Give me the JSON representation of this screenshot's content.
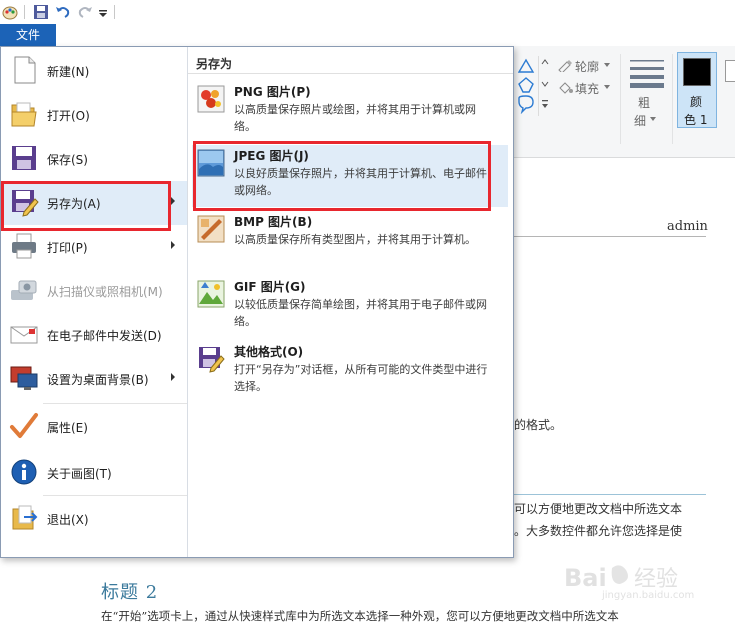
{
  "ribbon_tabs": {
    "file": "文件"
  },
  "ribbon": {
    "outline": "轮廓",
    "fill": "填充",
    "size_line1": "粗",
    "size_line2": "细",
    "color1_line1": "颜",
    "color1_line2": "色 1"
  },
  "document": {
    "author": "admin",
    "line_format": "的格式。",
    "line_a": "可以方便地更改文档中所选文本",
    "line_b": "。大多数控件都允许您选择是使",
    "heading2": "标题 2",
    "paragraph": "在“开始”选项卡上，通过从快速样式库中为所选文本选择一种外观，您可以方便地更改文档中所选文本"
  },
  "file_menu": {
    "items": [
      {
        "label": "新建(N)"
      },
      {
        "label": "打开(O)"
      },
      {
        "label": "保存(S)"
      },
      {
        "label": "另存为(A)"
      },
      {
        "label": "打印(P)"
      },
      {
        "label": "从扫描仪或照相机(M)"
      },
      {
        "label": "在电子邮件中发送(D)"
      },
      {
        "label": "设置为桌面背景(B)"
      },
      {
        "label": "属性(E)"
      },
      {
        "label": "关于画图(T)"
      },
      {
        "label": "退出(X)"
      }
    ]
  },
  "save_as": {
    "header": "另存为",
    "options": [
      {
        "title": "PNG 图片(P)",
        "desc": "以高质量保存照片或绘图，并将其用于计算机或网络。"
      },
      {
        "title": "JPEG 图片(J)",
        "desc": "以良好质量保存照片，并将其用于计算机、电子邮件或网络。"
      },
      {
        "title": "BMP 图片(B)",
        "desc": "以高质量保存所有类型图片，并将其用于计算机。"
      },
      {
        "title": "GIF 图片(G)",
        "desc": "以较低质量保存简单绘图，并将其用于电子邮件或网络。"
      },
      {
        "title": "其他格式(O)",
        "desc": "打开“另存为”对话框，从所有可能的文件类型中进行选择。"
      }
    ]
  },
  "watermark": "Bai 经验 jingyan.baidu.com",
  "colors": {
    "file_tab": "#1c63b7",
    "highlight": "#e8272e",
    "heading": "#3b7a9c"
  }
}
